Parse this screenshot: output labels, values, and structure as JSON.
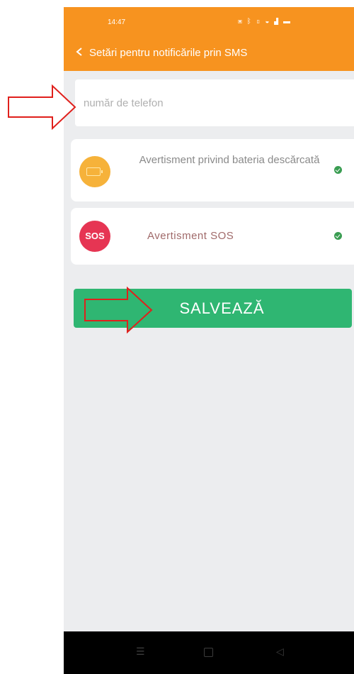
{
  "status_bar": {
    "time": "14:47",
    "icons": [
      "nfc-icon",
      "bluetooth-icon",
      "vibrate-icon",
      "wifi-icon",
      "signal-icon",
      "battery-icon"
    ]
  },
  "header": {
    "title": "Setări pentru notificările prin SMS",
    "back_icon": "chevron-left-icon"
  },
  "phone_input": {
    "placeholder": "număr de telefon",
    "value": ""
  },
  "alerts": [
    {
      "label": "Avertisment privind bateria descărcată",
      "icon": "battery-icon",
      "checked": true
    },
    {
      "label": "Avertisment SOS",
      "icon": "sos-icon",
      "icon_text": "SOS",
      "checked": true
    }
  ],
  "save_button": {
    "label": "SALVEAZĂ"
  },
  "nav": {
    "buttons": [
      "menu-icon",
      "home-icon",
      "back-icon"
    ]
  },
  "colors": {
    "header": "#f7931f",
    "background": "#ecedef",
    "save_button": "#2fb672",
    "battery_icon": "#f6b23a",
    "sos_icon": "#e63553",
    "check": "#3a9d52",
    "annotation_arrow": "#e0201c"
  }
}
